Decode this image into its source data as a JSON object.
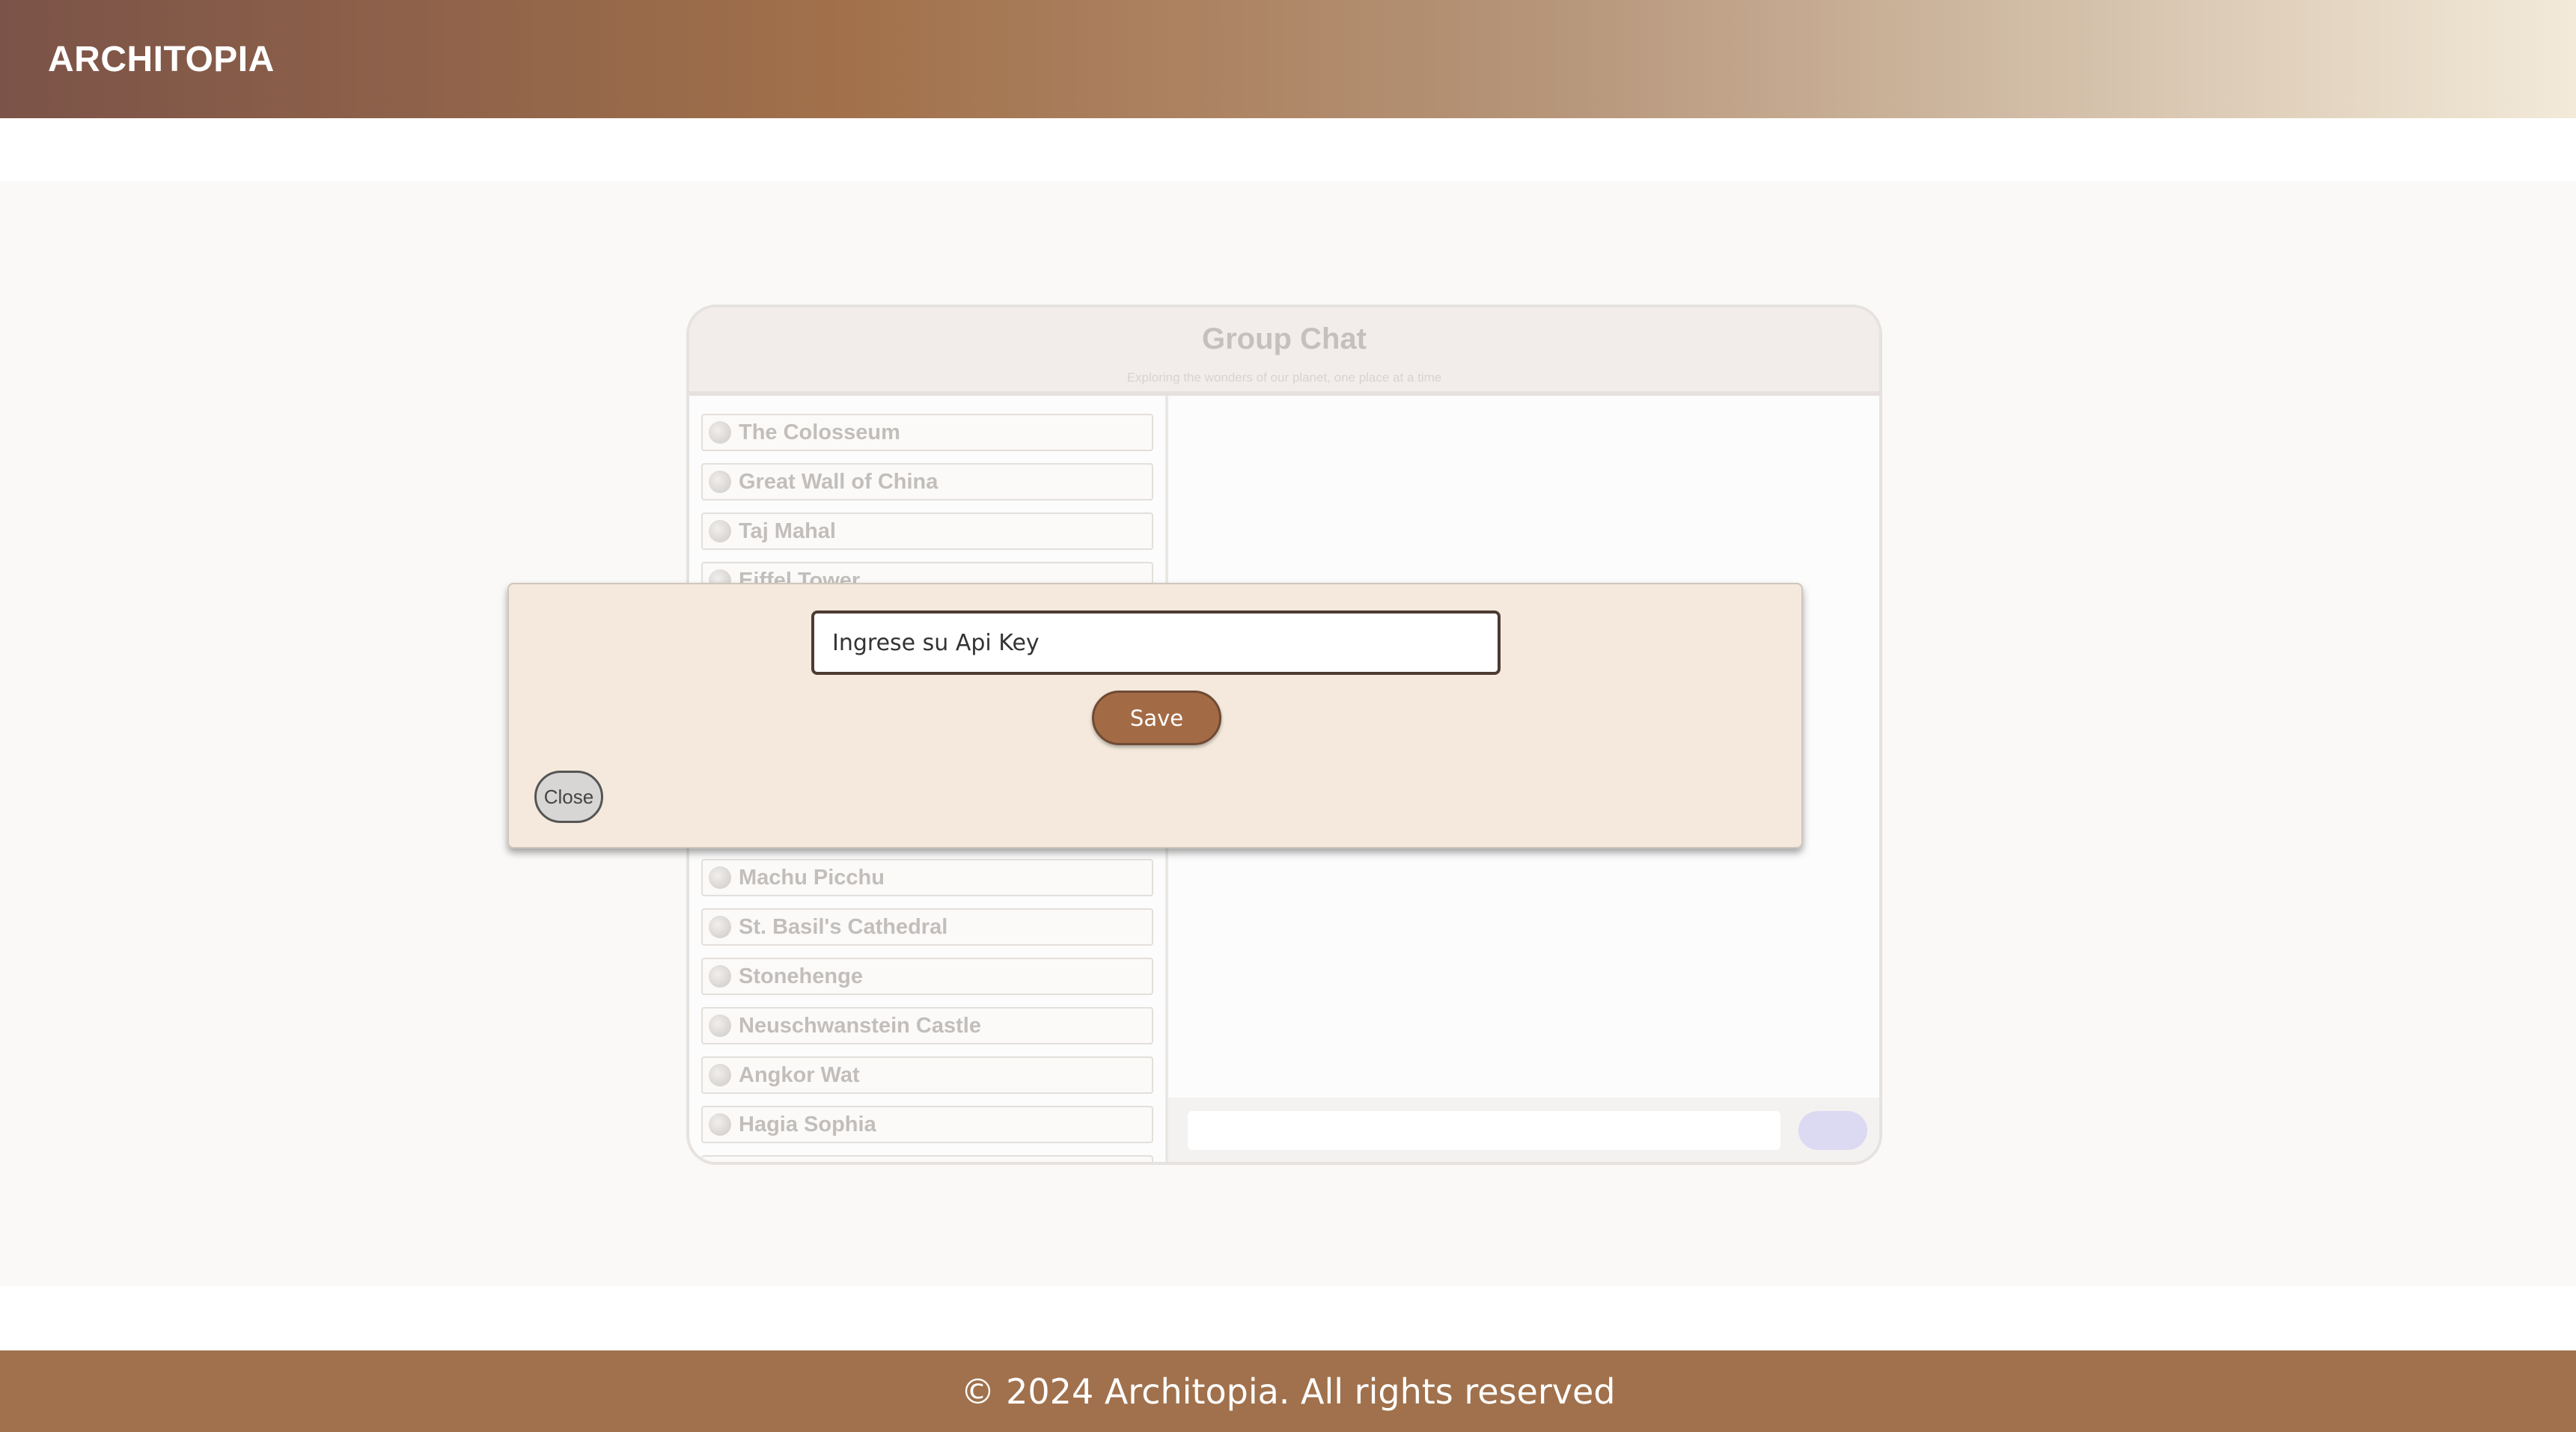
{
  "header": {
    "logo": "ARCHITOPIA"
  },
  "chat": {
    "title": "Group Chat",
    "subtitle": "Exploring the wonders of our planet, one place at a time",
    "places": [
      {
        "label": "The Colosseum"
      },
      {
        "label": "Great Wall of China"
      },
      {
        "label": "Taj Mahal"
      },
      {
        "label": "Eiffel Tower"
      },
      {
        "label": "Machu Picchu"
      },
      {
        "label": "St. Basil's Cathedral"
      },
      {
        "label": "Stonehenge"
      },
      {
        "label": "Neuschwanstein Castle"
      },
      {
        "label": "Angkor Wat"
      },
      {
        "label": "Hagia Sophia"
      }
    ]
  },
  "modal": {
    "api_input_value": "Ingrese su Api Key",
    "save_label": "Save",
    "close_label": "Close"
  },
  "footer": {
    "text": "© 2024 Architopia. All rights reserved"
  }
}
